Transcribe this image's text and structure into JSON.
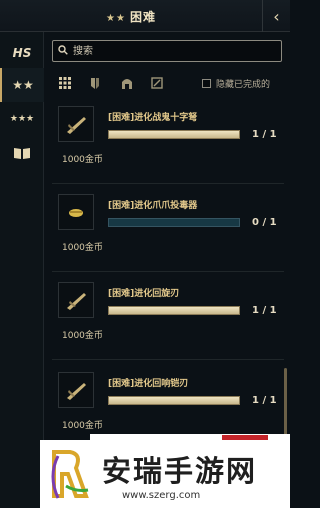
{
  "header": {
    "stars_icon": "two-stars-icon",
    "title": "困难",
    "close_icon": "chevron-left-icon"
  },
  "sidebar": {
    "items": [
      {
        "icon": "hs-logo-icon",
        "label": "HS"
      },
      {
        "icon": "two-stars-icon",
        "label": "★★"
      },
      {
        "icon": "three-stars-icon",
        "label": "★★★"
      },
      {
        "icon": "book-icon",
        "label": "book"
      }
    ],
    "active_index": 1
  },
  "search": {
    "placeholder": "搜索",
    "value": ""
  },
  "filters": {
    "tabs": [
      "grid-icon",
      "shield-icon",
      "helmet-icon",
      "box-icon"
    ],
    "hide_completed_label": "隐藏已完成的",
    "hide_completed_checked": false
  },
  "quests": [
    {
      "name": "[困难]进化战鬼十字弩",
      "progress": 1,
      "total": 1,
      "count_text": "1 / 1",
      "reward": "1000金币",
      "icon": "crossbow-icon"
    },
    {
      "name": "[困难]进化爪爪投毒器",
      "progress": 0,
      "total": 1,
      "count_text": "0 / 1",
      "reward": "1000金币",
      "icon": "poison-launcher-icon"
    },
    {
      "name": "[困难]进化回旋刃",
      "progress": 1,
      "total": 1,
      "count_text": "1 / 1",
      "reward": "1000金币",
      "icon": "boomerang-blade-icon"
    },
    {
      "name": "[困难]进化回响铠刃",
      "progress": 1,
      "total": 1,
      "count_text": "1 / 1",
      "reward": "1000金币",
      "icon": "echo-blade-icon"
    }
  ],
  "watermark": {
    "title": "安瑞手游网",
    "url": "www.szerg.com"
  },
  "colors": {
    "accent": "#c8a867",
    "bar_fill": "#e6dbb8",
    "bar_empty": "#173844",
    "background": "#0b1116"
  }
}
